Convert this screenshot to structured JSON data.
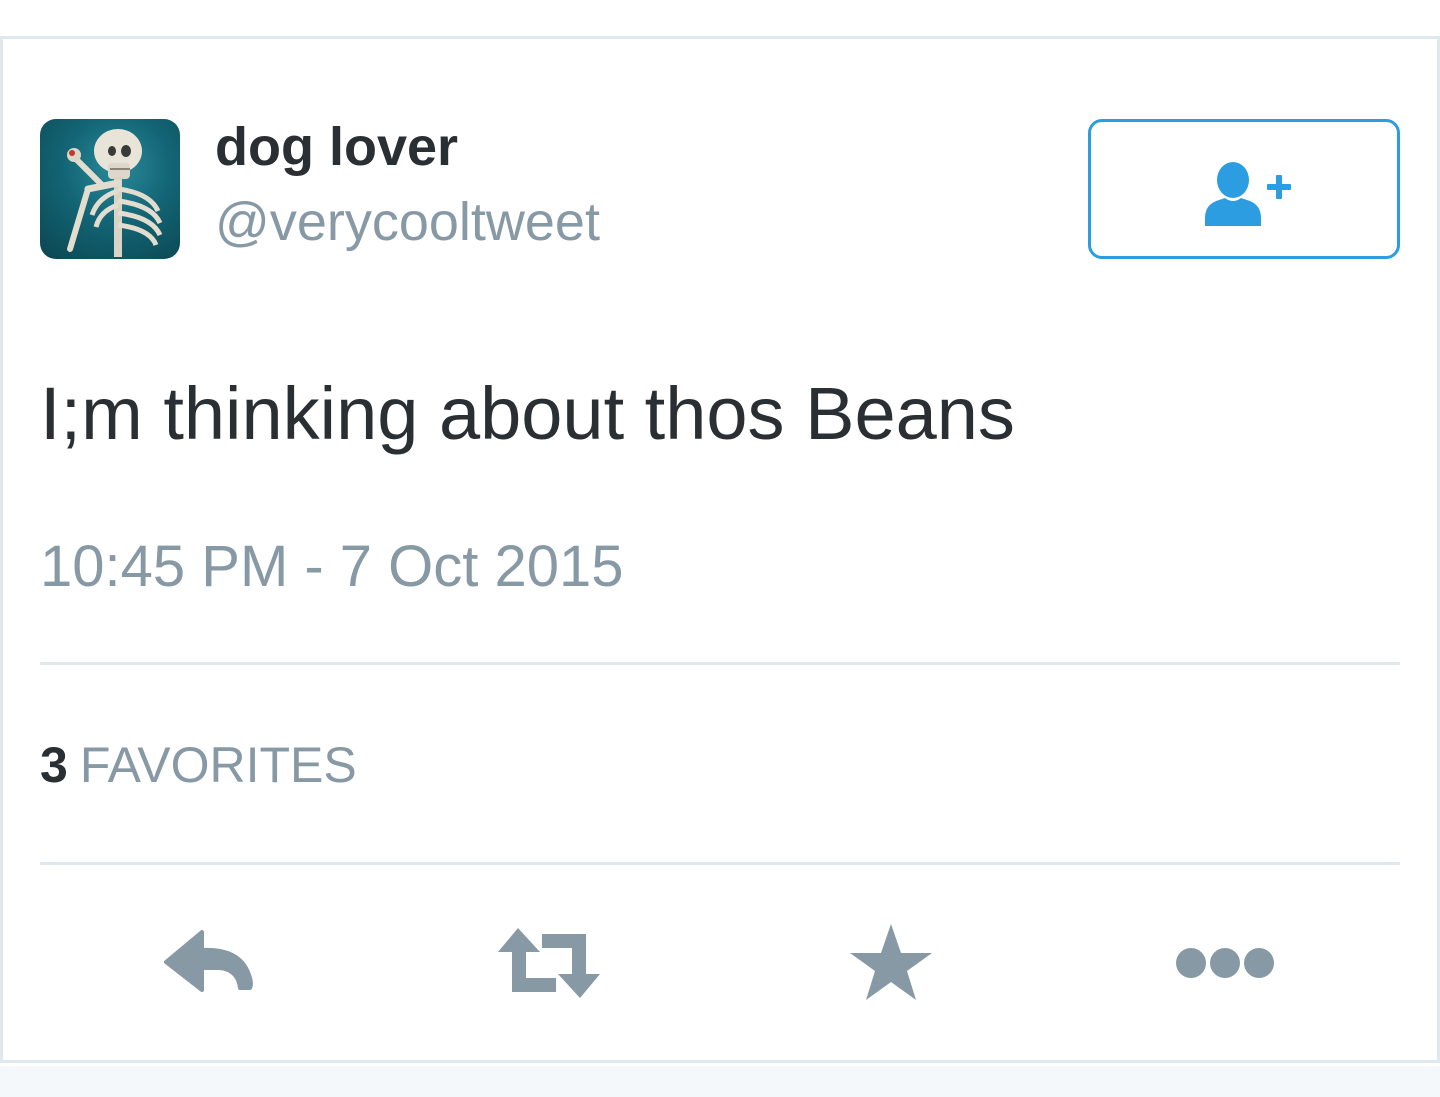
{
  "tweet": {
    "display_name": "dog lover",
    "handle": "@verycooltweet",
    "text": "I;m thinking about thos Beans",
    "timestamp": "10:45 PM - 7 Oct 2015",
    "favorites_count": "3",
    "favorites_label": "FAVORITES"
  },
  "icons": {
    "avatar": "skeleton-avatar",
    "follow": "follow-user-icon",
    "reply": "reply-icon",
    "retweet": "retweet-icon",
    "favorite": "star-icon",
    "more": "more-dots-icon"
  },
  "colors": {
    "accent": "#2b9de0",
    "text_primary": "#292f33",
    "text_secondary": "#8899a6",
    "icon_gray": "#8899a6",
    "divider": "#e1e8ed"
  }
}
